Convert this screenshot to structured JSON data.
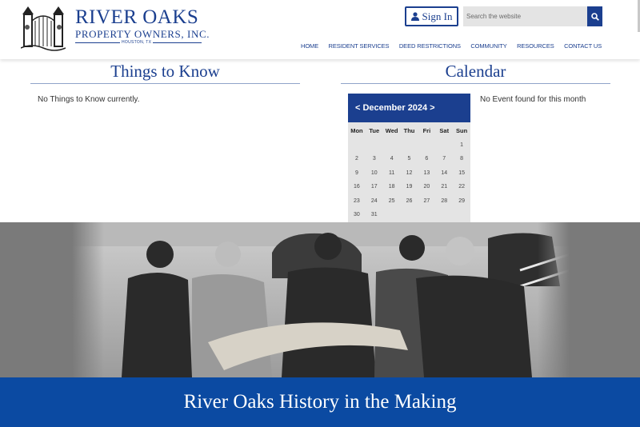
{
  "header": {
    "logo_title": "RIVER OAKS",
    "logo_subtitle": "PROPERTY OWNERS, INC.",
    "logo_city": "HOUSTON, TX",
    "signin_label": "Sign In",
    "search_placeholder": "Search the website",
    "nav": [
      "HOME",
      "RESIDENT SERVICES",
      "DEED RESTRICTIONS",
      "COMMUNITY",
      "RESOURCES",
      "CONTACT US"
    ]
  },
  "things": {
    "title": "Things to Know",
    "empty_message": "No Things to Know currently."
  },
  "calendar": {
    "title": "Calendar",
    "prev_arrow": "<",
    "month": "December 2024",
    "next_arrow": ">",
    "weekdays": [
      "Mon",
      "Tue",
      "Wed",
      "Thu",
      "Fri",
      "Sat",
      "Sun"
    ],
    "weeks": [
      [
        "",
        "",
        "",
        "",
        "",
        "",
        "1"
      ],
      [
        "2",
        "3",
        "4",
        "5",
        "6",
        "7",
        "8"
      ],
      [
        "9",
        "10",
        "11",
        "12",
        "13",
        "14",
        "15"
      ],
      [
        "16",
        "17",
        "18",
        "19",
        "20",
        "21",
        "22"
      ],
      [
        "23",
        "24",
        "25",
        "26",
        "27",
        "28",
        "29"
      ],
      [
        "30",
        "31",
        "",
        "",
        "",
        "",
        ""
      ]
    ],
    "no_event_message": "No Event found for this month"
  },
  "hero": {
    "banner_title": "River Oaks History in the Making"
  },
  "colors": {
    "brand_blue": "#1b3f8f",
    "banner_blue": "#0b4aa2",
    "calendar_bg": "#e4e4e4"
  },
  "icons": {
    "signin": "person-icon",
    "search": "magnifier-icon",
    "logo": "gate-emblem"
  }
}
